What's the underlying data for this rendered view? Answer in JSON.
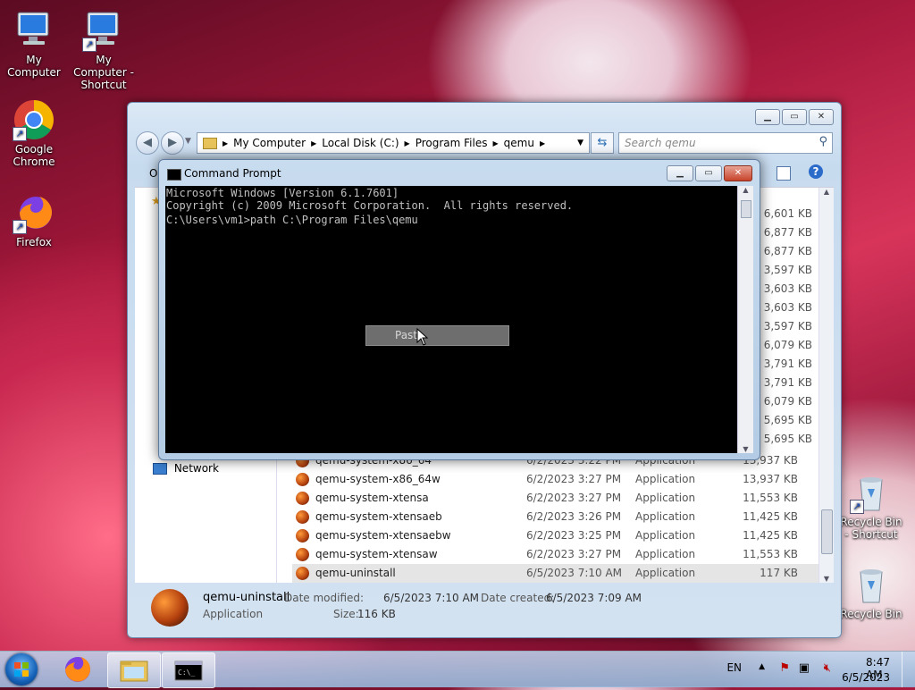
{
  "desktop": {
    "icons": [
      {
        "label": "My Computer"
      },
      {
        "label": "My Computer - Shortcut"
      },
      {
        "label": "Google Chrome"
      },
      {
        "label": "Firefox"
      },
      {
        "label": "Recycle Bin - Shortcut"
      },
      {
        "label": "Recycle Bin"
      }
    ]
  },
  "explorer": {
    "breadcrumb": [
      "My Computer",
      "Local Disk (C:)",
      "Program Files",
      "qemu"
    ],
    "search_placeholder": "Search qemu",
    "nav_network": "Network",
    "partial_o": "O",
    "sizes_hidden": [
      "6,601 KB",
      "6,877 KB",
      "6,877 KB",
      "3,597 KB",
      "3,603 KB",
      "3,603 KB",
      "3,597 KB",
      "6,079 KB",
      "3,791 KB",
      "3,791 KB",
      "6,079 KB",
      "5,695 KB",
      "5,695 KB"
    ],
    "files": [
      {
        "name": "qemu-system-x86_64",
        "date": "6/2/2023 3:22 PM",
        "type": "Application",
        "size": "13,937 KB"
      },
      {
        "name": "qemu-system-x86_64w",
        "date": "6/2/2023 3:27 PM",
        "type": "Application",
        "size": "13,937 KB"
      },
      {
        "name": "qemu-system-xtensa",
        "date": "6/2/2023 3:27 PM",
        "type": "Application",
        "size": "11,553 KB"
      },
      {
        "name": "qemu-system-xtensaeb",
        "date": "6/2/2023 3:26 PM",
        "type": "Application",
        "size": "11,425 KB"
      },
      {
        "name": "qemu-system-xtensaebw",
        "date": "6/2/2023 3:25 PM",
        "type": "Application",
        "size": "11,425 KB"
      },
      {
        "name": "qemu-system-xtensaw",
        "date": "6/2/2023 3:27 PM",
        "type": "Application",
        "size": "11,553 KB"
      },
      {
        "name": "qemu-uninstall",
        "date": "6/5/2023 7:10 AM",
        "type": "Application",
        "size": "117 KB"
      }
    ],
    "details": {
      "name": "qemu-uninstall",
      "type": "Application",
      "modified_label": "Date modified:",
      "modified_value": "6/5/2023 7:10 AM",
      "created_label": "Date created:",
      "created_value": "6/5/2023 7:09 AM",
      "size_label": "Size:",
      "size_value": "116 KB"
    }
  },
  "cmd": {
    "title": "Command Prompt",
    "lines": [
      "Microsoft Windows [Version 6.1.7601]",
      "Copyright (c) 2009 Microsoft Corporation.  All rights reserved.",
      "",
      "C:\\Users\\vm1>path C:\\Program Files\\qemu"
    ],
    "context_menu_item": "Paste"
  },
  "taskbar": {
    "language": "EN",
    "time": "8:47 AM",
    "date": "6/5/2023"
  }
}
